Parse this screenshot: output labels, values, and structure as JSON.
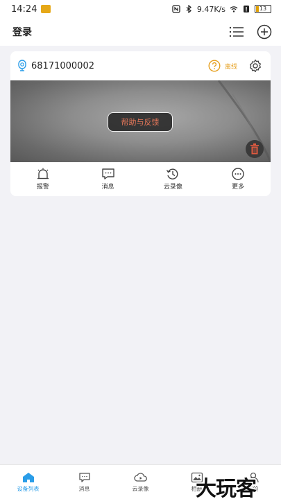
{
  "statusbar": {
    "time": "14:24",
    "network_speed": "9.47K/s",
    "battery": "13"
  },
  "header": {
    "login_label": "登录"
  },
  "device_card": {
    "device_id": "68171000002",
    "status_text": "离线",
    "help_button_label": "帮助与反馈",
    "actions": [
      {
        "label": "报警",
        "icon": "alarm-bell-icon"
      },
      {
        "label": "消息",
        "icon": "message-icon"
      },
      {
        "label": "云录像",
        "icon": "cloud-history-icon"
      },
      {
        "label": "更多",
        "icon": "more-icon"
      }
    ]
  },
  "tabbar": {
    "tabs": [
      {
        "label": "设备列表",
        "icon": "home-icon",
        "active": true
      },
      {
        "label": "消息",
        "icon": "message-icon"
      },
      {
        "label": "云录像",
        "icon": "cloud-video-icon"
      },
      {
        "label": "相册",
        "icon": "album-icon"
      },
      {
        "label": "我的",
        "icon": "profile-icon"
      }
    ]
  },
  "watermark": "大玩客",
  "colors": {
    "accent": "#2a9de8",
    "warning": "#e6a020",
    "help_text": "#e8785a"
  }
}
